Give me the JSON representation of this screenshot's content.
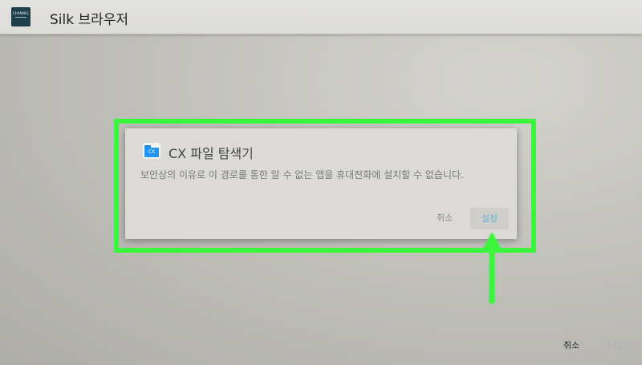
{
  "header": {
    "app_title": "Silk 브라우저",
    "logo_text": "CHANNEL"
  },
  "dialog": {
    "app_name": "CX 파일 탐색기",
    "app_icon_label": "CX",
    "message": "보안상의 이유로 이 경로를 통한 알 수 없는 앱을 휴대전화에 설치할 수 없습니다.",
    "cancel_label": "취소",
    "settings_label": "설정"
  },
  "footer": {
    "cancel_label": "취소",
    "next_label": "다음"
  },
  "colors": {
    "highlight": "#3bf53d",
    "settings_text": "#6ab4c8"
  }
}
